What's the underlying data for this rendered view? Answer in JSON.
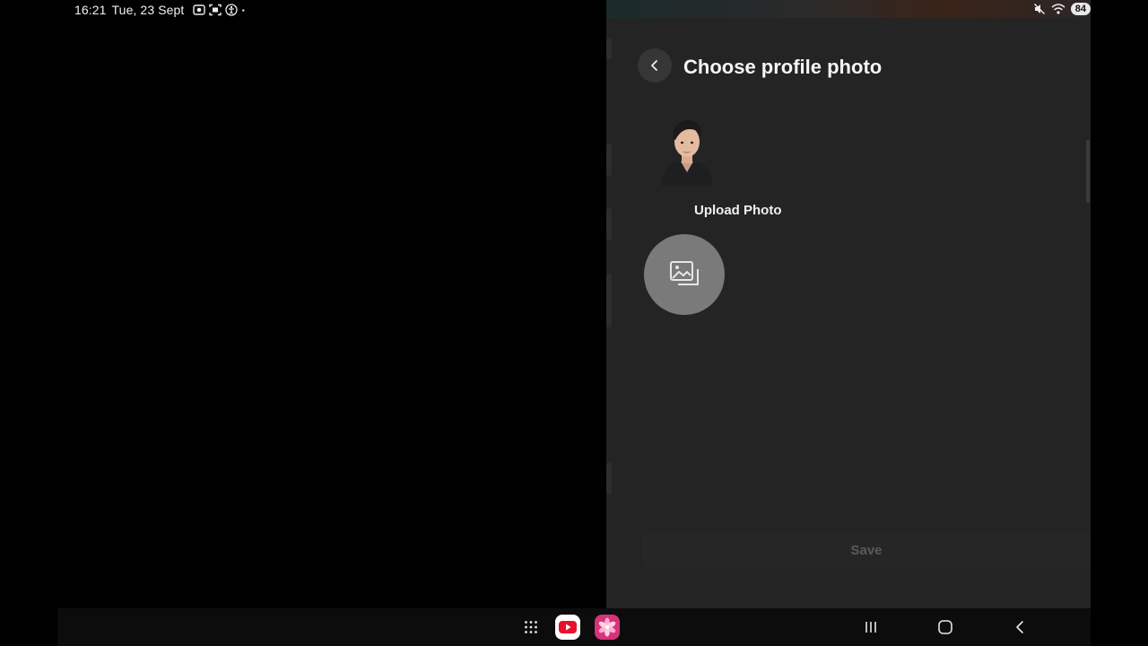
{
  "status_bar": {
    "time": "16:21",
    "date": "Tue, 23 Sept",
    "battery": "84",
    "icons_left": [
      "screen-record-icon",
      "screenshot-icon",
      "accessibility-icon",
      "dot-icon"
    ],
    "icons_right": [
      "mute-icon",
      "wifi-icon",
      "battery-icon"
    ]
  },
  "profile_photo_screen": {
    "title": "Choose profile photo",
    "back_icon": "chevron-left-icon",
    "avatar": "avatar-3d-character",
    "upload_label": "Upload Photo",
    "upload_icon": "gallery-icon",
    "save_label": "Save"
  },
  "navigation_bar": {
    "items": [
      "apps-grid-icon",
      "youtube-icon",
      "gallery-app-icon",
      "recents-icon",
      "home-icon",
      "back-icon"
    ]
  },
  "colors": {
    "background": "#000000",
    "panel": "#242424",
    "upload_button": "#7a7a7a",
    "save_disabled_text": "#5a5a5a",
    "youtube_red": "#e8112d"
  }
}
